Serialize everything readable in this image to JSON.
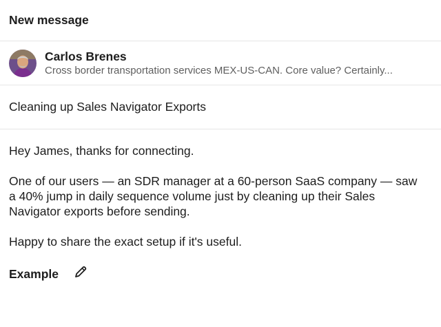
{
  "header": {
    "title": "New message"
  },
  "recipient": {
    "name": "Carlos Brenes",
    "headline": "Cross border transportation services MEX-US-CAN. Core value? Certainly..."
  },
  "subject": {
    "value": "Cleaning up Sales Navigator Exports"
  },
  "message": {
    "paragraphs": [
      "Hey James, thanks for connecting.",
      "One of our users — an SDR manager at a 60-person SaaS company — saw a 40% jump in daily sequence volume just by cleaning up their Sales Navigator exports before sending.",
      "Happy to share the exact setup if it's useful."
    ]
  },
  "footer": {
    "example_label": "Example",
    "edit_icon": "pencil-icon"
  },
  "colors": {
    "text": "#1d1d1d",
    "muted": "#5e5e5e",
    "divider": "#e6e6e6",
    "avatar_bg": "#6d4f8a"
  }
}
